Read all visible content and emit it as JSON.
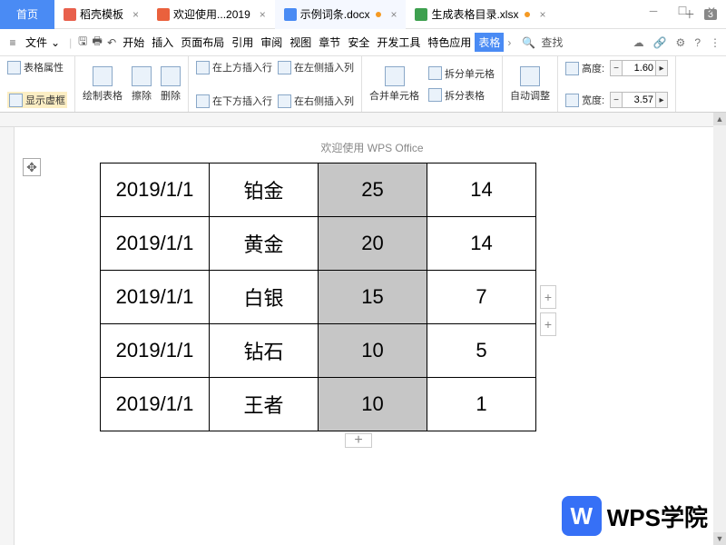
{
  "window": {
    "num": "3"
  },
  "tabs": {
    "home": "首页",
    "t1": "稻壳模板",
    "t2": "欢迎使用...2019",
    "t3": "示例词条.docx",
    "t4": "生成表格目录.xlsx"
  },
  "menu": {
    "file": "文件",
    "items": [
      "开始",
      "插入",
      "页面布局",
      "引用",
      "审阅",
      "视图",
      "章节",
      "安全",
      "开发工具",
      "特色应用",
      "表格"
    ],
    "search": "查找"
  },
  "ribbon": {
    "props": "表格属性",
    "show": "显示虚框",
    "draw": "绘制表格",
    "erase": "擦除",
    "del": "删除",
    "insUp": "在上方插入行",
    "insDown": "在下方插入行",
    "insLeft": "在左侧插入列",
    "insRight": "在右侧插入列",
    "merge": "合并单元格",
    "splitCell": "拆分单元格",
    "splitTbl": "拆分表格",
    "auto": "自动调整",
    "height": "高度:",
    "width": "宽度:",
    "hval": "1.60",
    "wval": "3.57"
  },
  "doc": {
    "title": "欢迎使用 WPS Office"
  },
  "table": {
    "rows": [
      {
        "c0": "2019/1/1",
        "c1": "铂金",
        "c2": "25",
        "c3": "14"
      },
      {
        "c0": "2019/1/1",
        "c1": "黄金",
        "c2": "20",
        "c3": "14"
      },
      {
        "c0": "2019/1/1",
        "c1": "白银",
        "c2": "15",
        "c3": "7"
      },
      {
        "c0": "2019/1/1",
        "c1": "钻石",
        "c2": "10",
        "c3": "5"
      },
      {
        "c0": "2019/1/1",
        "c1": "王者",
        "c2": "10",
        "c3": "1"
      }
    ]
  },
  "logo": "WPS学院"
}
